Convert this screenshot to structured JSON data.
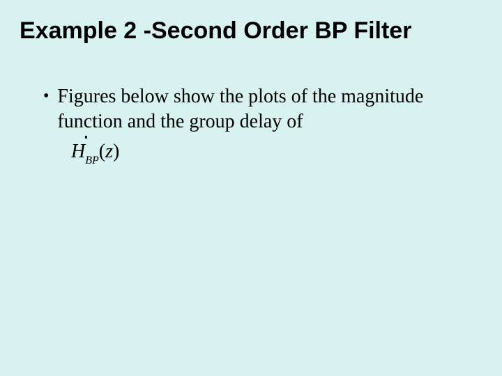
{
  "title": "Example 2 -Second Order BP Filter",
  "bullet": {
    "marker": "•",
    "text": "Figures below show the plots of the magnitude function and the group delay of"
  },
  "formula": {
    "H": "H",
    "dblprime": "''",
    "sub": "BP",
    "open": "(",
    "z": "z",
    "close": ")"
  }
}
